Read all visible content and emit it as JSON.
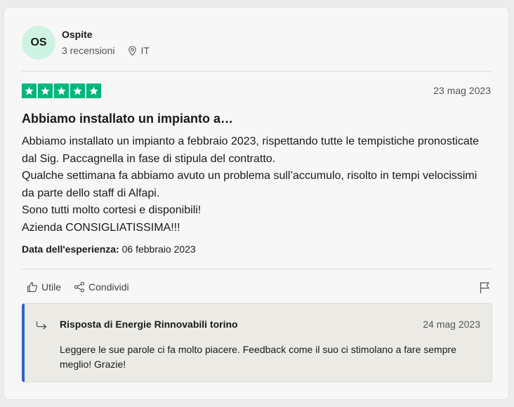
{
  "user": {
    "initials": "OS",
    "name": "Ospite",
    "review_count": "3 recensioni",
    "country": "IT"
  },
  "review": {
    "rating": 5,
    "star_color": "#00b67a",
    "date": "23 mag 2023",
    "title": "Abbiamo installato un impianto a…",
    "body": [
      "Abbiamo installato un impianto a febbraio 2023, rispettando tutte le tempistiche pronosticate dal Sig. Paccagnella in fase di stipula del contratto.",
      "Qualche settimana fa abbiamo avuto un problema sull’accumulo, risolto in tempi velocissimi da parte dello staff di Alfapi.",
      "Sono tutti molto cortesi e disponibili!",
      "Azienda CONSIGLIATISSIMA!!!"
    ],
    "experience_label": "Data dell'esperienza:",
    "experience_date": "06 febbraio 2023"
  },
  "actions": {
    "useful_label": "Utile",
    "share_label": "Condividi",
    "useful_icon": "thumbs-up-icon",
    "share_icon": "share-icon",
    "flag_icon": "flag-icon"
  },
  "reply": {
    "title": "Risposta di Energie Rinnovabili torino",
    "date": "24 mag 2023",
    "text": "Leggere le sue parole ci fa molto piacere. Feedback come il suo ci stimolano a fare sempre meglio! Grazie!",
    "accent_color": "#2b62d8"
  }
}
